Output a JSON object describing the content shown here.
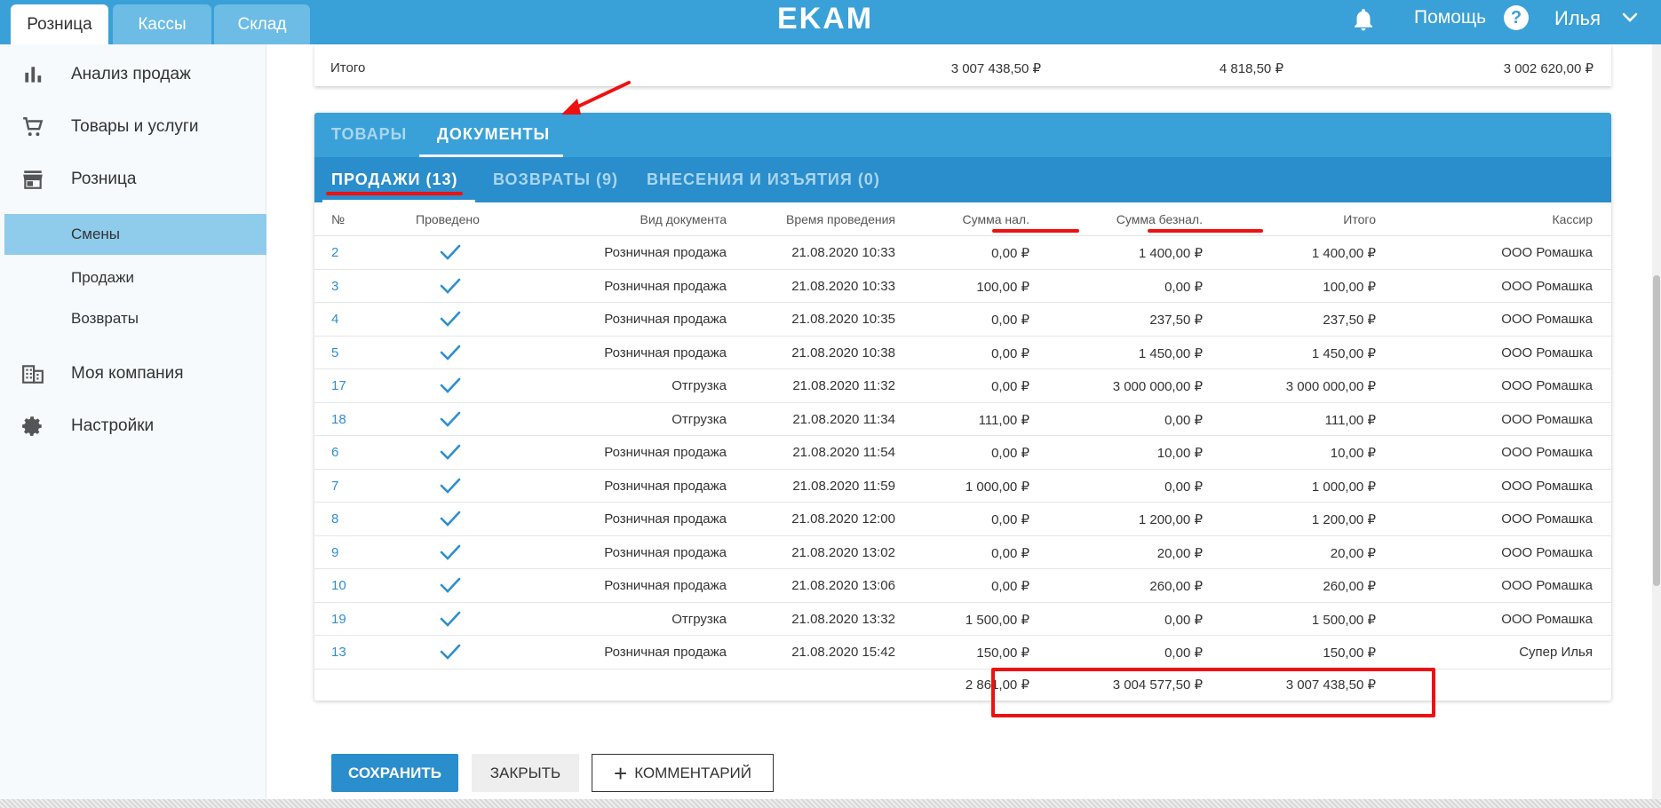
{
  "header": {
    "tabs": [
      {
        "label": "Розница",
        "active": true
      },
      {
        "label": "Кассы",
        "active": false
      },
      {
        "label": "Склад",
        "active": false
      }
    ],
    "logo": "EKAM",
    "help_label": "Помощь",
    "help_icon_text": "?",
    "user_name": "Илья"
  },
  "sidebar": {
    "items": [
      {
        "label": "Анализ продаж",
        "icon": "bar-chart-icon"
      },
      {
        "label": "Товары и услуги",
        "icon": "cart-icon"
      },
      {
        "label": "Розница",
        "icon": "store-icon"
      }
    ],
    "sub_items": [
      {
        "label": "Смены",
        "active": true
      },
      {
        "label": "Продажи",
        "active": false
      },
      {
        "label": "Возвраты",
        "active": false
      }
    ],
    "items_bottom": [
      {
        "label": "Моя компания",
        "icon": "building-icon"
      },
      {
        "label": "Настройки",
        "icon": "gear-icon"
      }
    ]
  },
  "summary": {
    "label": "Итого",
    "values": [
      "3 007 438,50 ₽",
      "4 818,50 ₽",
      "3 002 620,00 ₽"
    ]
  },
  "tabs_primary": [
    {
      "label": "ТОВАРЫ",
      "active": false
    },
    {
      "label": "ДОКУМЕНТЫ",
      "active": true
    }
  ],
  "tabs_secondary": [
    {
      "label": "ПРОДАЖИ (13)",
      "active": true
    },
    {
      "label": "ВОЗВРАТЫ (9)",
      "active": false
    },
    {
      "label": "ВНЕСЕНИЯ И ИЗЪЯТИЯ (0)",
      "active": false
    }
  ],
  "table": {
    "columns": [
      "№",
      "Проведено",
      "Вид документа",
      "Время проведения",
      "Сумма нал.",
      "Сумма безнал.",
      "Итого",
      "Кассир"
    ],
    "rows": [
      {
        "num": "2",
        "type": "Розничная продажа",
        "time": "21.08.2020 10:33",
        "cash": "0,00 ₽",
        "card": "1 400,00 ₽",
        "total": "1 400,00 ₽",
        "cashier": "ООО Ромашка"
      },
      {
        "num": "3",
        "type": "Розничная продажа",
        "time": "21.08.2020 10:33",
        "cash": "100,00 ₽",
        "card": "0,00 ₽",
        "total": "100,00 ₽",
        "cashier": "ООО Ромашка"
      },
      {
        "num": "4",
        "type": "Розничная продажа",
        "time": "21.08.2020 10:35",
        "cash": "0,00 ₽",
        "card": "237,50 ₽",
        "total": "237,50 ₽",
        "cashier": "ООО Ромашка"
      },
      {
        "num": "5",
        "type": "Розничная продажа",
        "time": "21.08.2020 10:38",
        "cash": "0,00 ₽",
        "card": "1 450,00 ₽",
        "total": "1 450,00 ₽",
        "cashier": "ООО Ромашка"
      },
      {
        "num": "17",
        "type": "Отгрузка",
        "time": "21.08.2020 11:32",
        "cash": "0,00 ₽",
        "card": "3 000 000,00 ₽",
        "total": "3 000 000,00 ₽",
        "cashier": "ООО Ромашка"
      },
      {
        "num": "18",
        "type": "Отгрузка",
        "time": "21.08.2020 11:34",
        "cash": "111,00 ₽",
        "card": "0,00 ₽",
        "total": "111,00 ₽",
        "cashier": "ООО Ромашка"
      },
      {
        "num": "6",
        "type": "Розничная продажа",
        "time": "21.08.2020 11:54",
        "cash": "0,00 ₽",
        "card": "10,00 ₽",
        "total": "10,00 ₽",
        "cashier": "ООО Ромашка"
      },
      {
        "num": "7",
        "type": "Розничная продажа",
        "time": "21.08.2020 11:59",
        "cash": "1 000,00 ₽",
        "card": "0,00 ₽",
        "total": "1 000,00 ₽",
        "cashier": "ООО Ромашка"
      },
      {
        "num": "8",
        "type": "Розничная продажа",
        "time": "21.08.2020 12:00",
        "cash": "0,00 ₽",
        "card": "1 200,00 ₽",
        "total": "1 200,00 ₽",
        "cashier": "ООО Ромашка"
      },
      {
        "num": "9",
        "type": "Розничная продажа",
        "time": "21.08.2020 13:02",
        "cash": "0,00 ₽",
        "card": "20,00 ₽",
        "total": "20,00 ₽",
        "cashier": "ООО Ромашка"
      },
      {
        "num": "10",
        "type": "Розничная продажа",
        "time": "21.08.2020 13:06",
        "cash": "0,00 ₽",
        "card": "260,00 ₽",
        "total": "260,00 ₽",
        "cashier": "ООО Ромашка"
      },
      {
        "num": "19",
        "type": "Отгрузка",
        "time": "21.08.2020 13:32",
        "cash": "1 500,00 ₽",
        "card": "0,00 ₽",
        "total": "1 500,00 ₽",
        "cashier": "ООО Ромашка"
      },
      {
        "num": "13",
        "type": "Розничная продажа",
        "time": "21.08.2020 15:42",
        "cash": "150,00 ₽",
        "card": "0,00 ₽",
        "total": "150,00 ₽",
        "cashier": "Супер Илья"
      }
    ],
    "totals": {
      "cash": "2 861,00 ₽",
      "card": "3 004 577,50 ₽",
      "total": "3 007 438,50 ₽"
    }
  },
  "buttons": {
    "save": "СОХРАНИТЬ",
    "close": "ЗАКРЫТЬ",
    "comment": "КОММЕНТАРИЙ"
  },
  "colors": {
    "primary": "#3aa0d8",
    "primary_dark": "#2a8dcc",
    "annotation": "#ee1111"
  }
}
